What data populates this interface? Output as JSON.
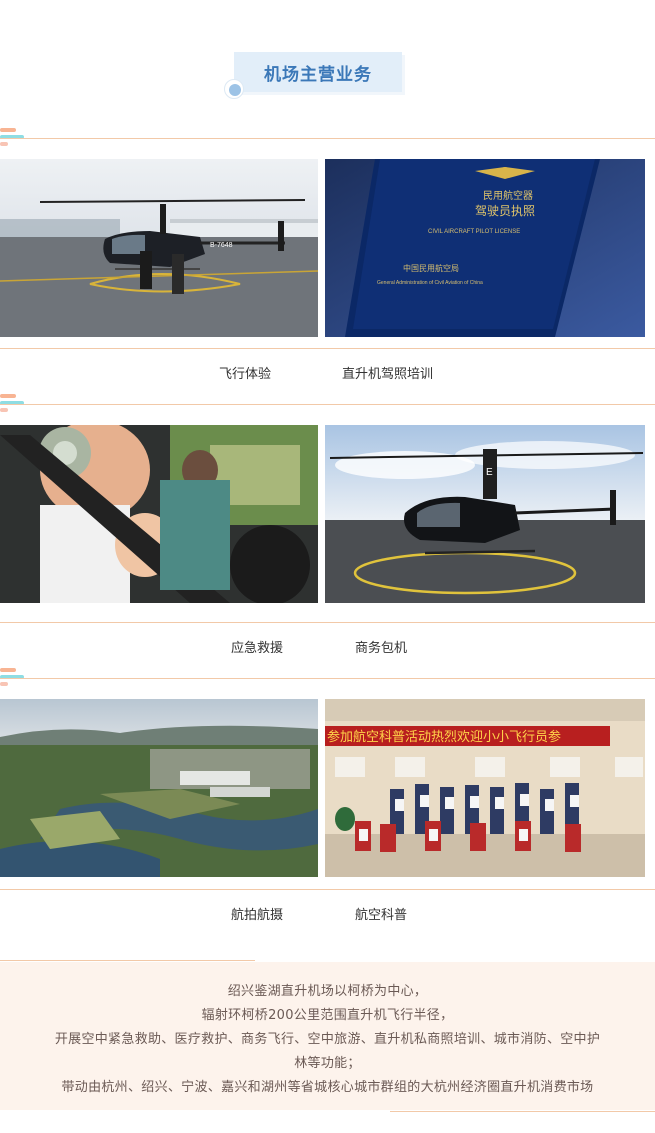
{
  "header": {
    "title": "机场主营业务"
  },
  "services": [
    {
      "label": "飞行体验"
    },
    {
      "label": "直升机驾照培训"
    },
    {
      "label": "应急救援"
    },
    {
      "label": "商务包机"
    },
    {
      "label": "航拍航摄"
    },
    {
      "label": "航空科普"
    }
  ],
  "photos": {
    "helicopter_tail": "B-7648",
    "license_title_1": "民用航空器",
    "license_title_2": "驾驶员执照",
    "license_en": "CIVIL AIRCRAFT PILOT LICENSE",
    "license_issuer": "中国民用航空局",
    "license_issuer_en": "General Administration of Civil Aviation of China",
    "helicopter_tail_letter": "E",
    "banner": "参加航空科普活动热烈欢迎小小飞行员参"
  },
  "intro": {
    "lines": [
      "绍兴鉴湖直升机场以柯桥为中心，",
      "辐射环柯桥200公里范围直升机飞行半径，",
      "开展空中紧急救助、医疗救护、商务飞行、空中旅游、直升机私商照培训、城市消防、空中护",
      "林等功能；",
      "带动由杭州、绍兴、宁波、嘉兴和湖州等省城核心城市群组的大杭州经济圈直升机消费市场"
    ]
  },
  "colors": {
    "accent_blue": "#3b78b8",
    "badge_bg": "#e2eef9",
    "rule": "#f2c9a8",
    "info_bg": "#fdf3ec"
  }
}
